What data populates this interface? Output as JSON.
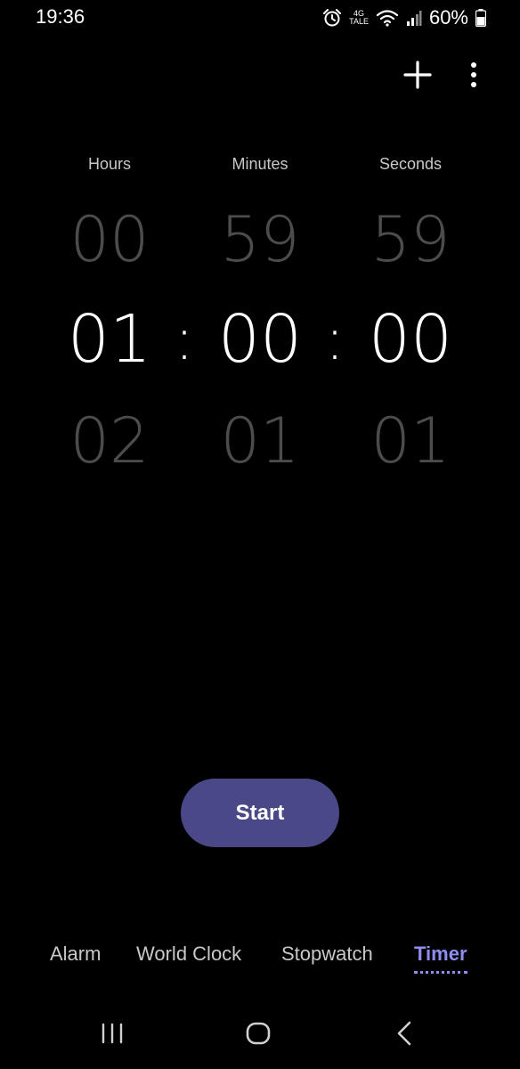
{
  "status_bar": {
    "time": "19:36",
    "network_top": "4G",
    "network_bottom": "TALE",
    "battery_percent": "60%",
    "icons": [
      "alarm-icon",
      "wifi-icon",
      "signal-icon",
      "battery-icon"
    ]
  },
  "toolbar": {
    "icons": [
      "plus-icon",
      "more-vertical-icon"
    ]
  },
  "picker": {
    "hours": {
      "label": "Hours",
      "prev": "00",
      "current": "01",
      "next": "02"
    },
    "minutes": {
      "label": "Minutes",
      "prev": "59",
      "current": "00",
      "next": "01"
    },
    "seconds": {
      "label": "Seconds",
      "prev": "59",
      "current": "00",
      "next": "01"
    },
    "separator": ":"
  },
  "start_button": {
    "label": "Start"
  },
  "tabs": [
    {
      "label": "Alarm",
      "active": false
    },
    {
      "label": "World Clock",
      "active": false
    },
    {
      "label": "Stopwatch",
      "active": false
    },
    {
      "label": "Timer",
      "active": true
    }
  ],
  "nav_bar": {
    "icons": [
      "recent-apps-icon",
      "home-icon",
      "back-icon"
    ]
  },
  "colors": {
    "background": "#000000",
    "accent": "#8d8ef0",
    "start_button": "#4a4887",
    "dim_number": "#4c4c4c"
  }
}
